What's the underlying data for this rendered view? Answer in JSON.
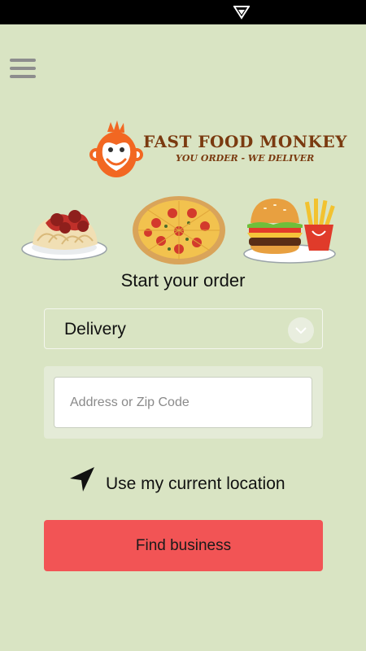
{
  "status_bar": {
    "icon": "signal-icon"
  },
  "header": {
    "menu_icon": "hamburger-menu-icon"
  },
  "logo": {
    "brand": "FAST FOOD MONKEY",
    "tagline": "YOU ORDER - WE DELIVER",
    "icon": "monkey-logo-icon",
    "colors": {
      "primary": "#f26722",
      "text": "#7a3a10"
    }
  },
  "food_images": [
    "spaghetti-icon",
    "pizza-icon",
    "burger-fries-icon"
  ],
  "order": {
    "title": "Start your order",
    "type_select": {
      "value": "Delivery",
      "icon": "chevron-down-icon"
    },
    "address": {
      "value": "",
      "placeholder": "Address or Zip Code"
    },
    "use_location_label": "Use my current location",
    "location_icon": "navigation-arrow-icon",
    "find_button_label": "Find business"
  },
  "colors": {
    "background": "#d9e4c3",
    "button": "#f25455",
    "status_bar": "#000000"
  }
}
